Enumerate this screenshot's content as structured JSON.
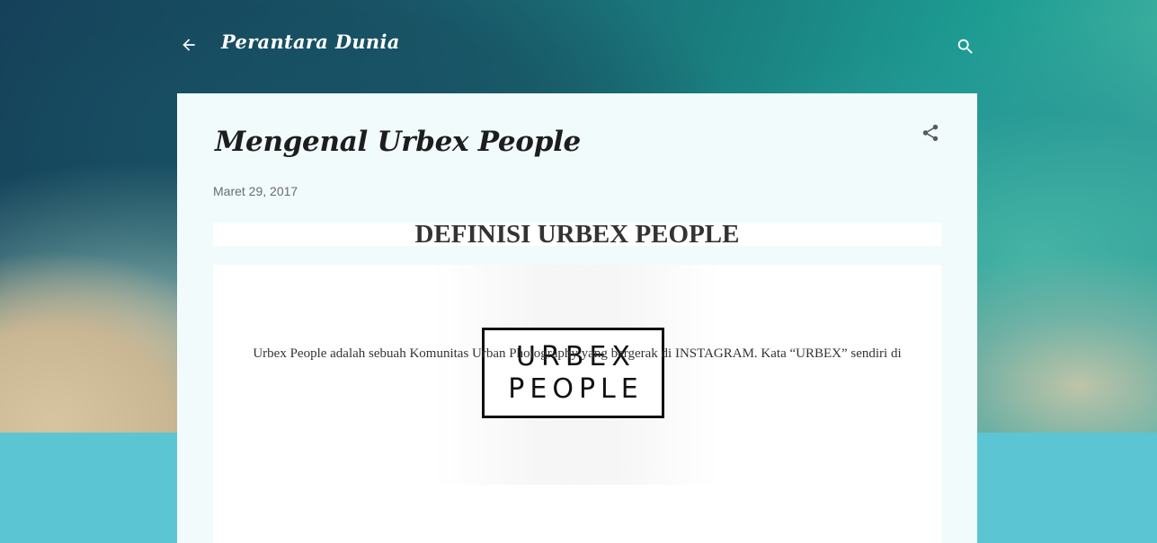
{
  "header": {
    "blog_title": "Perantara Dunia",
    "back_icon": "arrow-back-icon",
    "search_icon": "search-icon"
  },
  "post": {
    "title": "Mengenal Urbex People",
    "date": "Maret 29, 2017",
    "share_icon": "share-icon",
    "heading": "DEFINISI URBEX PEOPLE",
    "logo": {
      "line1": "URBEX",
      "line2": "PEOPLE"
    },
    "body_text": "Urbex People adalah sebuah Komunitas Urban Photography yang bergerak di INSTAGRAM.  Kata “URBEX” sendiri di"
  },
  "colors": {
    "header_text": "#ffffff",
    "card_background": "#f1fbfb",
    "page_background": "#5bc5d4",
    "title_text": "#1d1d1d",
    "date_text": "#6b6b6b"
  }
}
